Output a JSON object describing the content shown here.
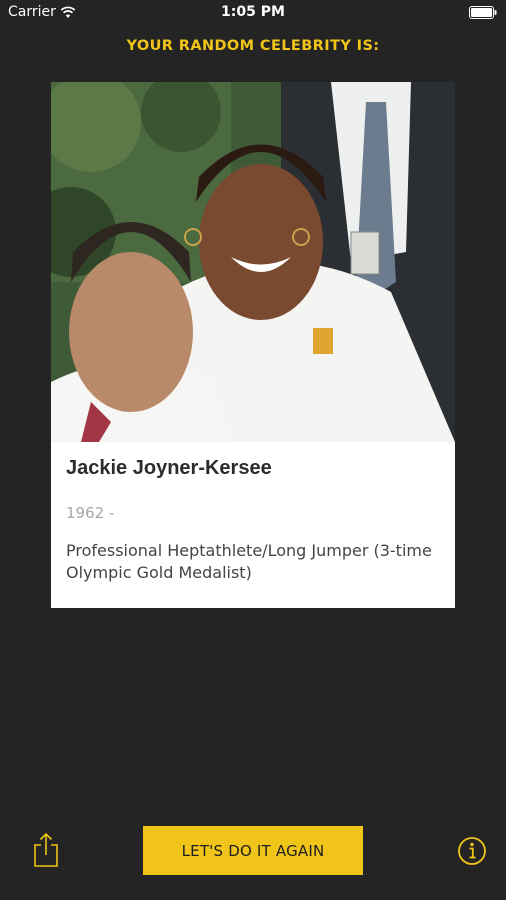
{
  "status_bar": {
    "carrier": "Carrier",
    "time": "1:05 PM"
  },
  "heading": "YOUR RANDOM CELEBRITY IS:",
  "celebrity": {
    "name": "Jackie Joyner-Kersee",
    "years": "1962 -",
    "description": "Professional Heptathlete/Long Jumper (3-time Olympic Gold Medalist)",
    "photo_icon": "celebrity-photo"
  },
  "toolbar": {
    "again_label": "LET'S DO IT AGAIN",
    "share_icon": "share-icon",
    "info_icon": "info-icon"
  },
  "colors": {
    "background": "#242424",
    "accent": "#f0c419",
    "card": "#ffffff"
  }
}
